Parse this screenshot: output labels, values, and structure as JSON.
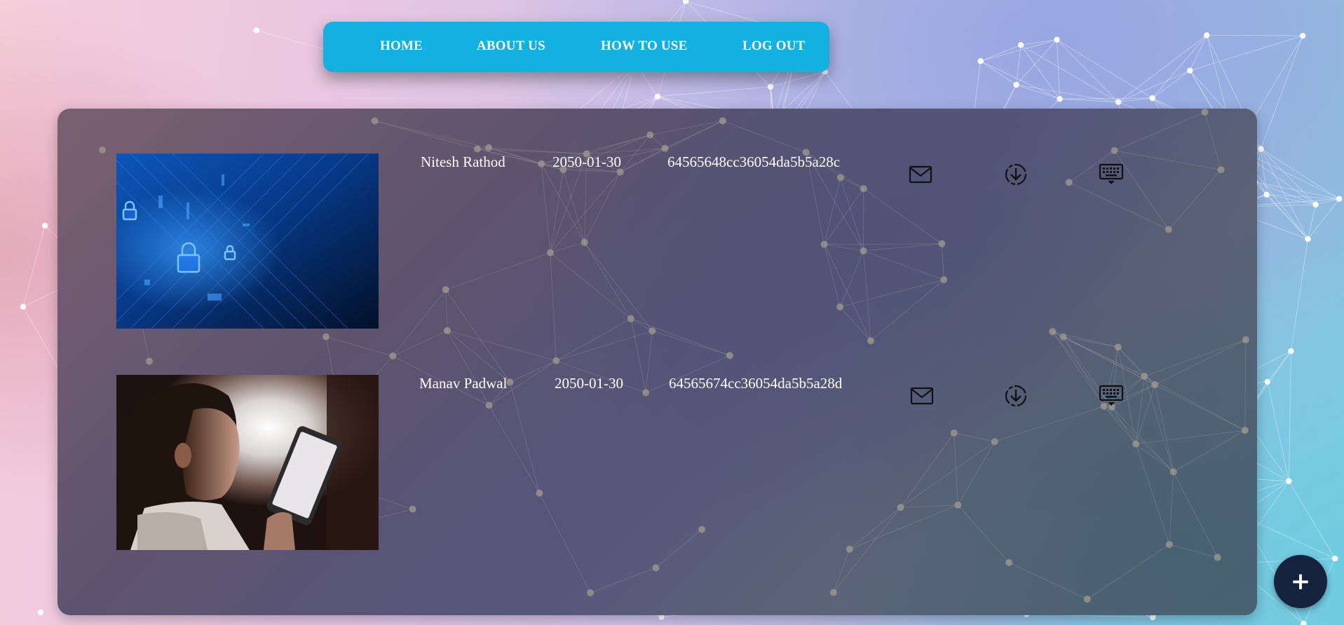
{
  "nav": {
    "home": "HOME",
    "about": "ABOUT US",
    "how_to_use": "HOW TO USE",
    "logout": "LOG OUT"
  },
  "records": [
    {
      "name": "Nitesh Rathod",
      "date": "2050-01-30",
      "id": "64565648cc36054da5b5a28c",
      "image": "cyber-security-lock-image"
    },
    {
      "name": "Manav Padwal",
      "date": "2050-01-30",
      "id": "64565674cc36054da5b5a28d",
      "image": "child-with-tablet-image"
    }
  ],
  "actions": {
    "mail_icon": "mail-icon",
    "download_icon": "download-circle-icon",
    "keyboard_icon": "keyboard-icon"
  },
  "fab": {
    "label": "+"
  },
  "colors": {
    "nav_background": "#12b1e1",
    "nav_text": "#ffffff",
    "fab_background": "#16233f",
    "panel_text": "#ffffff"
  }
}
